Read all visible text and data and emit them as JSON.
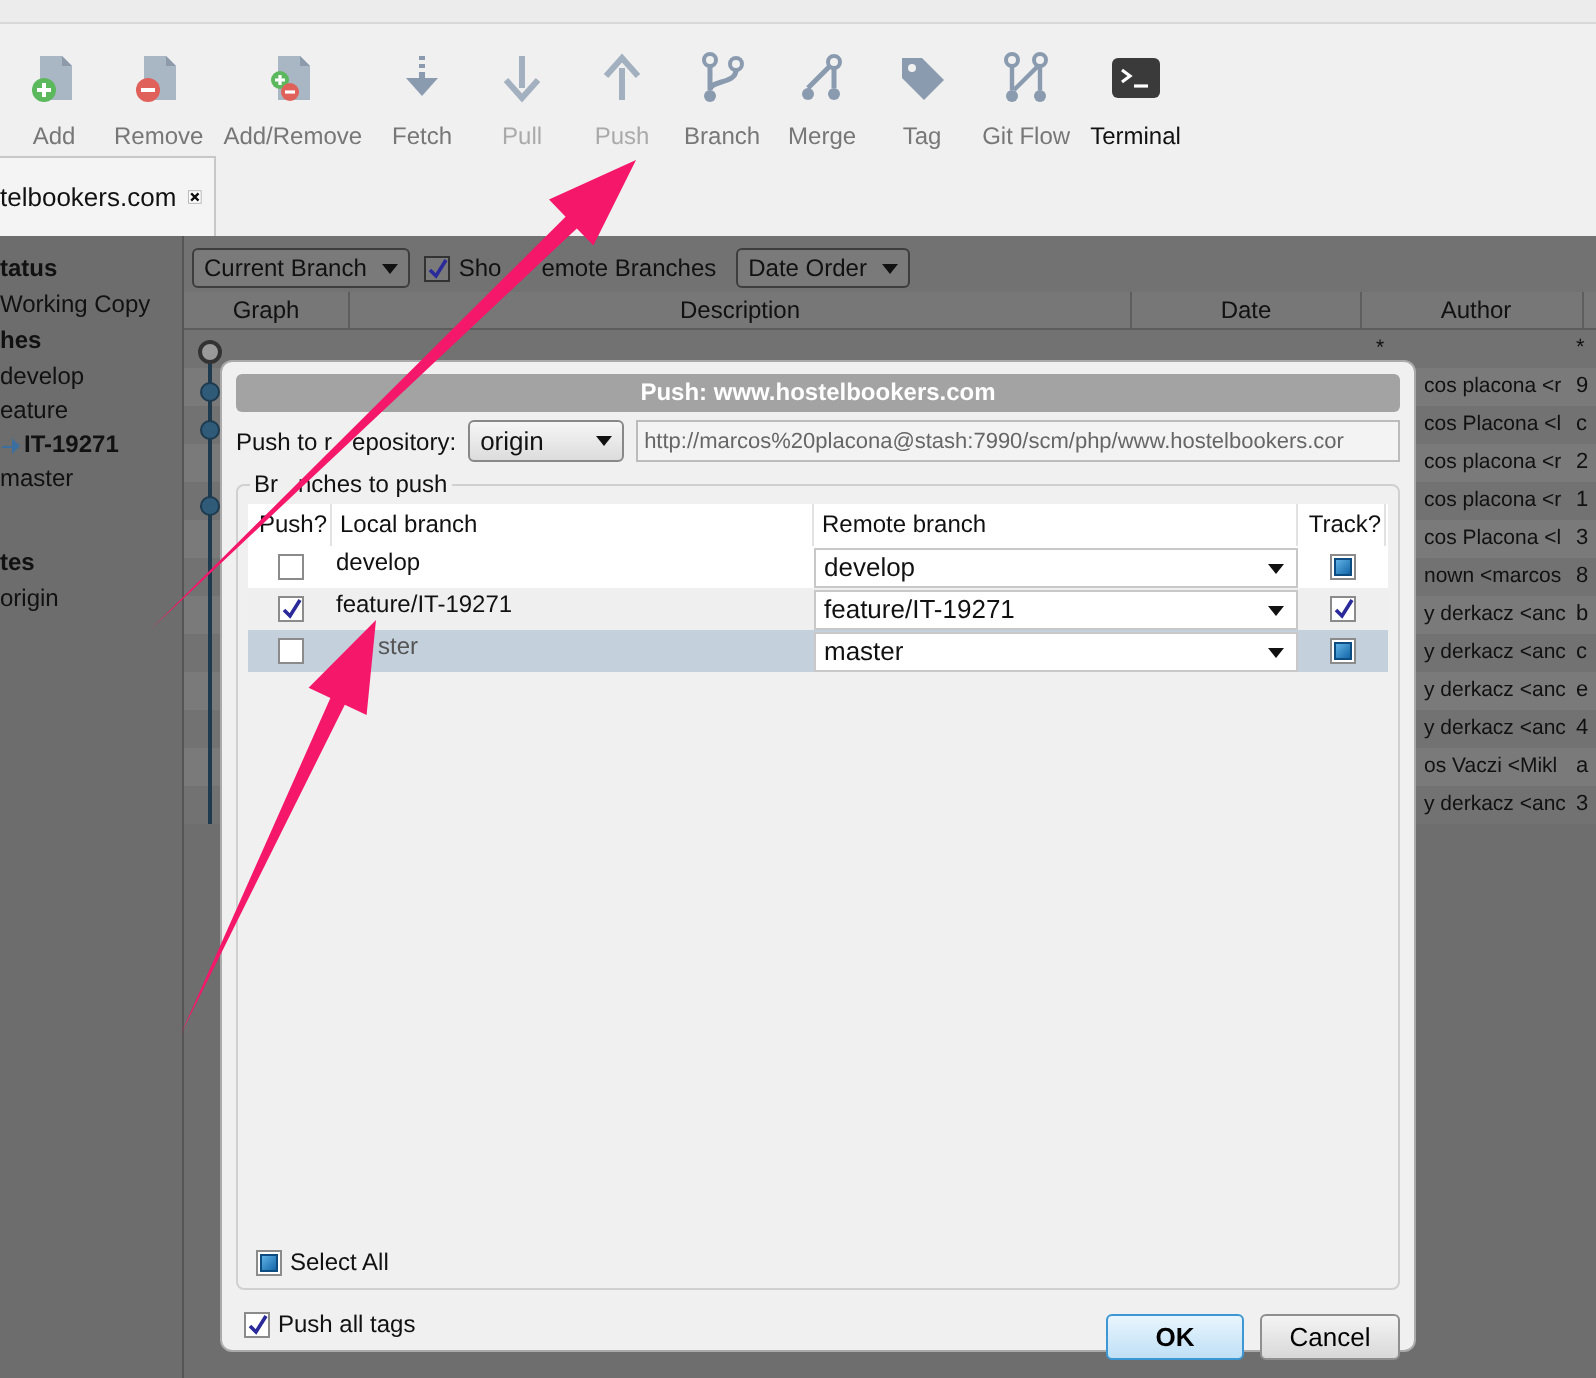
{
  "toolbar": [
    {
      "label": "Add",
      "kind": "add",
      "disabled": false
    },
    {
      "label": "Remove",
      "kind": "remove",
      "disabled": false
    },
    {
      "label": "Add/Remove",
      "kind": "addremove",
      "disabled": false
    },
    {
      "label": "Fetch",
      "kind": "fetch",
      "disabled": false
    },
    {
      "label": "Pull",
      "kind": "pull",
      "disabled": true
    },
    {
      "label": "Push",
      "kind": "push",
      "disabled": true
    },
    {
      "label": "Branch",
      "kind": "branch",
      "disabled": false
    },
    {
      "label": "Merge",
      "kind": "merge",
      "disabled": false
    },
    {
      "label": "Tag",
      "kind": "tag",
      "disabled": false
    },
    {
      "label": "Git Flow",
      "kind": "gitflow",
      "disabled": false
    },
    {
      "label": "Terminal",
      "kind": "terminal",
      "disabled": false
    }
  ],
  "tab": {
    "label": "telbookers.com"
  },
  "sidebar": [
    {
      "title": "tatus",
      "items": [
        {
          "label": "Working Copy",
          "current": false
        }
      ]
    },
    {
      "title": "hes",
      "items": [
        {
          "label": "develop",
          "current": false
        },
        {
          "label": "eature",
          "current": false
        },
        {
          "label": "IT-19271",
          "current": true
        },
        {
          "label": "master",
          "current": false
        }
      ]
    },
    {
      "title": "tes",
      "items": [
        {
          "label": "origin",
          "current": false
        }
      ]
    }
  ],
  "filter": {
    "branch": "Current Branch",
    "show_remote": {
      "label_parts": [
        "Sho",
        "emote Branches"
      ],
      "checked": true
    },
    "order": "Date Order"
  },
  "table": {
    "columns": [
      "Graph",
      "Description",
      "Date",
      "Author"
    ],
    "rows": [
      {
        "author": "*",
        "column_5": "*"
      },
      {
        "author": "cos placona <r",
        "column_5": "9"
      },
      {
        "author": "cos Placona <l",
        "column_5": "c"
      },
      {
        "author": "cos placona <r",
        "column_5": "2"
      },
      {
        "author": "cos placona <r",
        "column_5": "1"
      },
      {
        "author": "cos Placona <l",
        "column_5": "3"
      },
      {
        "author": "nown <marcos",
        "column_5": "8"
      },
      {
        "author": "y derkacz <anc",
        "column_5": "b"
      },
      {
        "author": "y derkacz <anc",
        "column_5": "c"
      },
      {
        "author": "y derkacz <anc",
        "column_5": "e"
      },
      {
        "author": "y derkacz <anc",
        "column_5": "4"
      },
      {
        "author": "os Vaczi <Mikl",
        "column_5": "a"
      },
      {
        "author": "y derkacz <anc",
        "column_5": "3"
      }
    ]
  },
  "dialog": {
    "title": "Push: www.hostelbookers.com",
    "repo_label_parts": [
      "Push to r",
      "epository:"
    ],
    "repo": "origin",
    "url": "http://marcos%20placona@stash:7990/scm/php/www.hostelbookers.cor",
    "group_parts": [
      "Br",
      "nches to push"
    ],
    "columns": [
      "Push?",
      "Local branch",
      "Remote branch",
      "Track?"
    ],
    "rows": [
      {
        "push": false,
        "local": "develop",
        "remote": "develop",
        "track": false,
        "track_mixed": true,
        "selected": false
      },
      {
        "push": true,
        "local": "feature/IT-19271",
        "remote": "feature/IT-19271",
        "track": true,
        "track_mixed": false,
        "selected": false
      },
      {
        "push": false,
        "local": "ster",
        "remote": "master",
        "track": false,
        "track_mixed": true,
        "selected": true
      }
    ],
    "select_all": {
      "label": "Select All",
      "checked": false,
      "mixed": true
    },
    "push_tags": {
      "label": "Push all tags",
      "checked": true
    },
    "buttons": [
      {
        "label": "OK",
        "default": true
      },
      {
        "label": "Cancel",
        "default": false
      }
    ]
  }
}
